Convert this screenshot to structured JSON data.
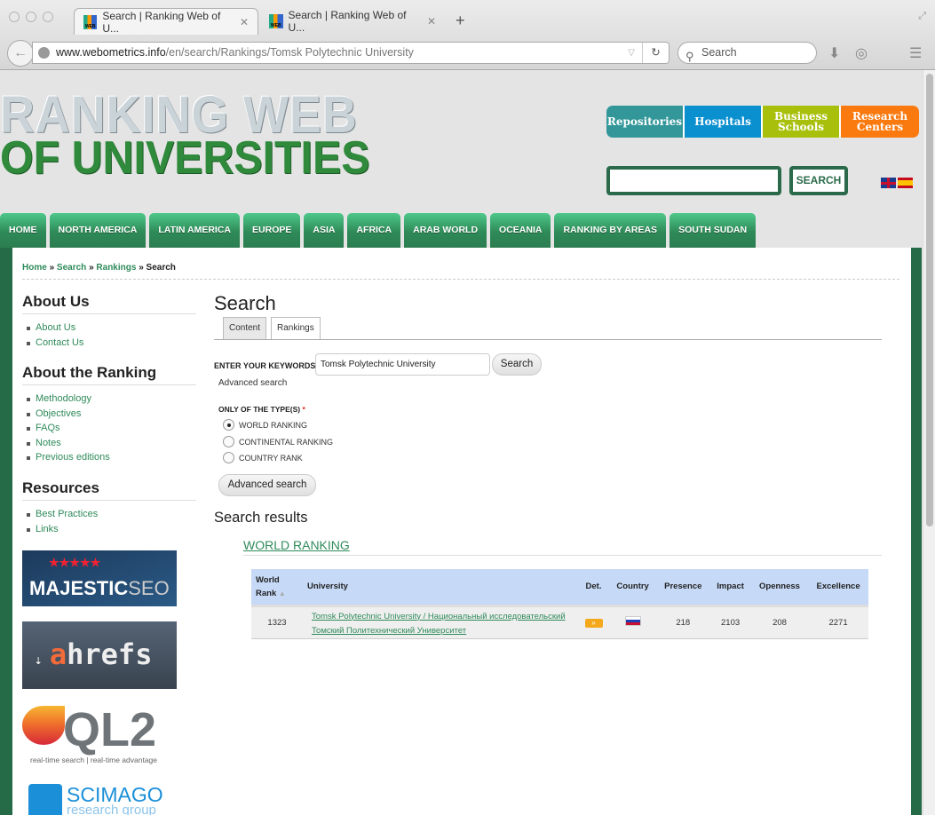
{
  "browser": {
    "tabs": [
      {
        "title": "Search | Ranking Web of U..."
      },
      {
        "title": "Search | Ranking Web of U..."
      }
    ],
    "url_domain": "www.webometrics.info",
    "url_path": "/en/search/Rankings/Tomsk Polytechnic University",
    "search_placeholder": "Search"
  },
  "header": {
    "logo_line1": "RANKING WEB",
    "logo_line2": "OF UNIVERSITIES",
    "sites": [
      {
        "label": "Repositories",
        "color": "#33979a"
      },
      {
        "label": "Hospitals",
        "color": "#0a8fcf"
      },
      {
        "label": "Business Schools",
        "color": "#a8c00c"
      },
      {
        "label": "Research Centers",
        "color": "#fa7a10"
      }
    ],
    "search_button": "SEARCH"
  },
  "nav": [
    "HOME",
    "NORTH AMERICA",
    "LATIN AMERICA",
    "EUROPE",
    "ASIA",
    "AFRICA",
    "ARAB WORLD",
    "OCEANIA",
    "RANKING BY AREAS",
    "SOUTH SUDAN"
  ],
  "breadcrumb": {
    "home": "Home",
    "search": "Search",
    "rankings": "Rankings",
    "sep": "»",
    "current": "Search"
  },
  "sidebar": {
    "sections": [
      {
        "title": "About Us",
        "items": [
          "About Us",
          "Contact Us"
        ]
      },
      {
        "title": "About the Ranking",
        "items": [
          "Methodology",
          "Objectives",
          "FAQs",
          "Notes",
          "Previous editions"
        ]
      },
      {
        "title": "Resources",
        "items": [
          "Best Practices",
          "Links"
        ]
      }
    ],
    "ads": {
      "majestic": "MAJESTIC",
      "majestic2": "SEO",
      "ahrefs_a": "a",
      "ahrefs": "hrefs",
      "ql2": "QL2",
      "ql2_tag": "real-time search | real-time advantage",
      "scimago": "SCIMAGO",
      "scimago_sub": "research group"
    }
  },
  "main": {
    "title": "Search",
    "tabs": [
      "Content",
      "Rankings"
    ],
    "keywords_label": "ENTER YOUR KEYWORDS",
    "keywords_value": "Tomsk Polytechnic University",
    "search_button": "Search",
    "advanced_link": "Advanced search",
    "type_label": "ONLY OF THE TYPE(S)",
    "required": "*",
    "types": [
      "WORLD RANKING",
      "CONTINENTAL RANKING",
      "COUNTRY RANK"
    ],
    "selected_type": "WORLD RANKING",
    "advanced_button": "Advanced search",
    "results_title": "Search results",
    "results_section": "WORLD RANKING",
    "table": {
      "headers": [
        "World Rank",
        "University",
        "Det.",
        "Country",
        "Presence",
        "Impact",
        "Openness",
        "Excellence"
      ],
      "rows": [
        {
          "rank": "1323",
          "university": "Tomsk Polytechnic University / Национальный исследовательский Томский Политехнический Университет",
          "det": "»",
          "country": "Russia",
          "presence": "218",
          "impact": "2103",
          "openness": "208",
          "excellence": "2271"
        }
      ]
    }
  }
}
